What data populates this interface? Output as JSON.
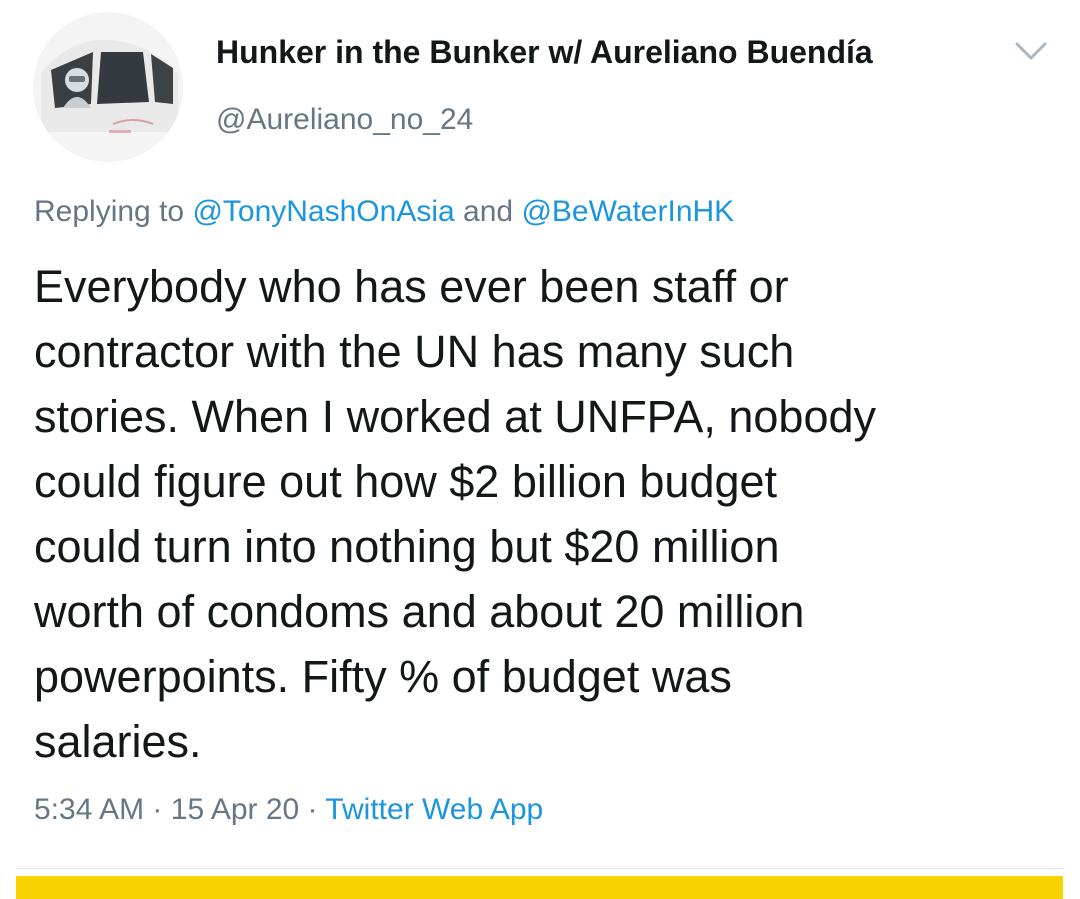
{
  "tweet": {
    "display_name": "Hunker in the Bunker w/ Aureliano Buendía",
    "handle": "@Aureliano_no_24",
    "avatar_icon": "avatar-photo-pilot-cockpit",
    "menu_icon": "chevron-down-icon",
    "replying_prefix": "Replying to",
    "reply_mention_1": "@TonyNashOnAsia",
    "reply_conjunction": "and",
    "reply_mention_2": "@BeWaterInHK",
    "text": "Everybody who has ever been staff or\ncontractor with the UN has many such\nstories. When I worked at UNFPA, nobody\ncould figure out how  $2 billion budget\ncould turn into nothing but $20 million\nworth of condoms and about 20 million\npowerpoints. Fifty % of budget was\nsalaries.",
    "time": "5:34 AM",
    "separator": "·",
    "date": "15 Apr 20",
    "source": "Twitter Web App"
  },
  "colors": {
    "text": "#14171a",
    "secondary": "#657786",
    "link": "#1b95e0",
    "divider": "#e1e8ed",
    "bottom_bar": "#f9d301"
  }
}
